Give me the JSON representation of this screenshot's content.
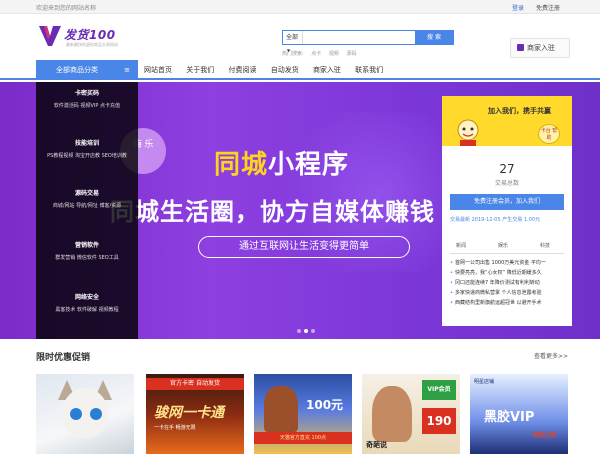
{
  "topbar": {
    "welcome": "欢迎来到您的网站名称",
    "login": "登录",
    "register": "免费注册"
  },
  "brand": {
    "name": "发货100",
    "tagline": "最新最快的虚拟商品交易网站"
  },
  "search": {
    "category": "全部",
    "placeholder": "",
    "button": "搜 索",
    "hot_label": "热门搜索:",
    "hot": [
      "点卡",
      "视频",
      "源码"
    ]
  },
  "merchant": {
    "label": "商家入驻"
  },
  "nav": {
    "category_label": "全部商品分类",
    "links": [
      "网站首页",
      "关于我们",
      "付费阅读",
      "自动发货",
      "商家入驻",
      "联系我们"
    ]
  },
  "categories": [
    {
      "title": "卡密买码",
      "items": [
        "软件激活码",
        "视频VIP",
        "点卡充值"
      ]
    },
    {
      "title": "技能培训",
      "items": [
        "PS教程视频",
        "淘宝开店教",
        "SEO培训教"
      ]
    },
    {
      "title": "源码交易",
      "items": [
        "商城/网站",
        "导航/网址",
        "博客/资源"
      ]
    },
    {
      "title": "营销软件",
      "items": [
        "群发营销",
        "微信软件",
        "SEO工具"
      ]
    },
    {
      "title": "网络安全",
      "items": [
        "黑客技术",
        "软件破解",
        "视频教程"
      ]
    }
  ],
  "banner": {
    "bubble": "嗨 乐",
    "title_yellow": "同城",
    "title_white": "小程序",
    "subtitle": "同城生活圈，协方自媒体赚钱",
    "cta": "通过互联网让生活变得更简单",
    "slides": 3,
    "active_slide": 1
  },
  "card": {
    "headline": "加入我们，携手共赢",
    "badge": "卡台 帮助",
    "count": "27",
    "count_label": "交易总数",
    "join_button": "免费注册会员，加入我们",
    "latest": "交易最新  2019-12-05 产生交易 1.00元",
    "tabs": [
      "新闻",
      "娱乐",
      "科技"
    ],
    "news": [
      "首网一公司出售 1000万美元资金 平均一",
      "快要亮亮，我“心女权” 降低近期缓多久",
      "冈口还能连续7 年降价测试有利利转动",
      "多家快递商微私营掌 个人信息泄露考验",
      "西藏结构里新旗航运超冠世 以避开手术"
    ]
  },
  "promo": {
    "title": "限时优惠促销",
    "more": "查看更多>>"
  },
  "products": [
    {
      "alt": "cat"
    },
    {
      "band": "官方卡密 自动发货",
      "big": "骏网一卡通",
      "sub": "一卡在手 畅游无限"
    },
    {
      "num": "100元",
      "bar": "天猫官方直充 100点"
    },
    {
      "vip": "VIP会员",
      "num": "190",
      "caption": "奇葩说"
    },
    {
      "logo": "明星店铺",
      "big": "黑胶VIP",
      "stamp": "电商之家"
    }
  ]
}
